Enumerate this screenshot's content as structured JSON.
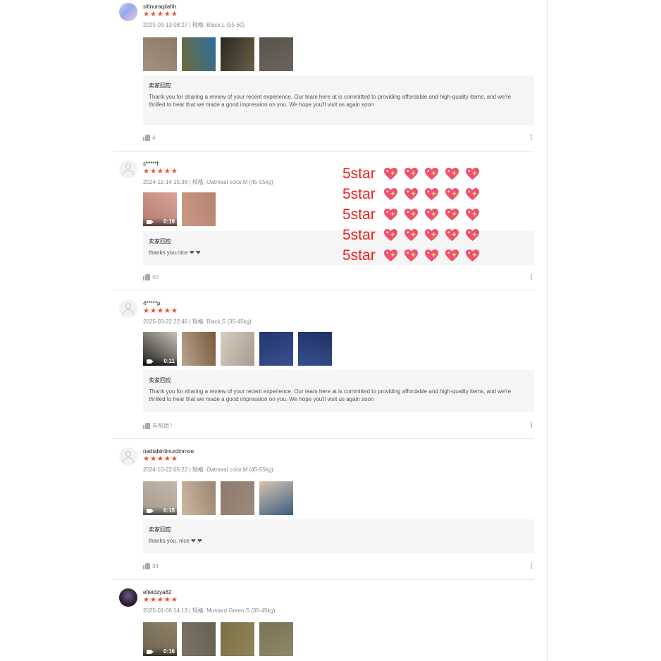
{
  "reviews": [
    {
      "username": "sitinuraqilahh",
      "rating_stars": "★★★★★",
      "meta": "2025-03-13 08:27 | 规格: Black,L (55-60)",
      "thumbs": [
        {
          "colors": [
            "#a39280",
            "#8b7a68"
          ]
        },
        {
          "colors": [
            "#6f6a3a",
            "#2d6f9c"
          ]
        },
        {
          "colors": [
            "#2a2722",
            "#6a5f44"
          ]
        },
        {
          "colors": [
            "#58524c",
            "#6b655d"
          ]
        }
      ],
      "reply_title": "卖家回应",
      "reply_text": "Thank you for sharing a review of your recent experience. Our team here at is committed to providing affordable and high-quality items, and we're thrilled to hear that we made a good impression on you. We hope you'll visit us again soon",
      "likes": "4"
    },
    {
      "username": "s*****f",
      "rating_stars": "★★★★★",
      "meta": "2024-12-14 15:36 | 规格: Oatmeal color,M (45-55kg)",
      "thumbs": [
        {
          "colors": [
            "#b27a6e",
            "#d9a495"
          ],
          "video": "0:19"
        },
        {
          "colors": [
            "#c99986",
            "#b7836f"
          ]
        }
      ],
      "reply_title": "卖家回应",
      "reply_text": "thanks you.nice ❤ ❤",
      "likes": "40"
    },
    {
      "username": "4*****p",
      "rating_stars": "★★★★★",
      "meta": "2025-03-22 22:46 | 规格: Black,S (35-45kg)",
      "thumbs": [
        {
          "colors": [
            "#1f1f1e",
            "#c9c2b8"
          ],
          "video": "0:11"
        },
        {
          "colors": [
            "#b9a48d",
            "#7a5a3c"
          ]
        },
        {
          "colors": [
            "#d7cec4",
            "#a89b8c"
          ]
        },
        {
          "colors": [
            "#22366d",
            "#3a4f8f"
          ]
        },
        {
          "colors": [
            "#1e3163",
            "#36508d"
          ]
        }
      ],
      "reply_title": "卖家回应",
      "reply_text": "Thank you for sharing a review of your recent experience. Our team here at is committed to providing affordable and high-quality items, and we're thrilled to hear that we made a good impression on you. We hope you'll visit us again soon",
      "likes": "有帮助？"
    },
    {
      "username": "nadiabintinurdinmoe",
      "rating_stars": "★★★★★",
      "meta": "2024-10-22 05:22 | 规格: Oatmeal color,M (45-55kg)",
      "thumbs": [
        {
          "colors": [
            "#a79a8d",
            "#c4b7a9"
          ],
          "video": "0:15"
        },
        {
          "colors": [
            "#cdb9a2",
            "#9a8570"
          ]
        },
        {
          "colors": [
            "#8d7a6d",
            "#9c8a7c"
          ]
        },
        {
          "colors": [
            "#d8c2ae",
            "#3a5e83"
          ]
        }
      ],
      "reply_title": "卖家回应",
      "reply_text": "thanks you. nice ❤ ❤",
      "likes": "34"
    },
    {
      "username": "efieidzya82",
      "rating_stars": "★★★★★",
      "meta": "2025-01-06 14:13 | 规格: Mustard Green,S (35-45kg)",
      "thumbs": [
        {
          "colors": [
            "#6f6550",
            "#8c8066"
          ],
          "video": "0:16"
        },
        {
          "colors": [
            "#7c7464",
            "#675f52"
          ]
        },
        {
          "colors": [
            "#7b6f45",
            "#918457"
          ]
        },
        {
          "colors": [
            "#7a7256",
            "#8f8768"
          ]
        }
      ]
    }
  ],
  "overlay": {
    "label": "5star",
    "rows": 5,
    "hearts_per_row": 5,
    "label_color": "#f0201c"
  },
  "colors": {
    "star": "#ee4d2d",
    "reply_bg": "#f5f5f5",
    "heart": "#f0506e"
  }
}
